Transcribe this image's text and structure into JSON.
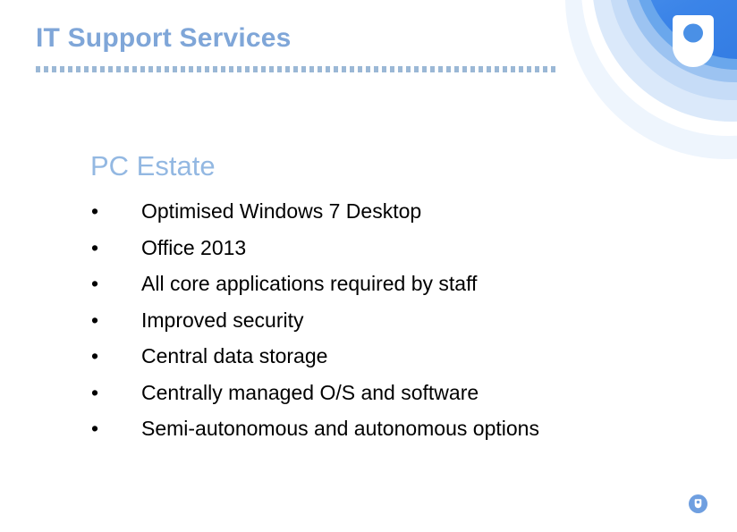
{
  "slide": {
    "title": "IT Support Services",
    "subheading": "PC Estate",
    "bullet_marker": "•",
    "bullets": [
      "Optimised Windows 7 Desktop",
      "Office 2013",
      "All core applications required by staff",
      "Improved security",
      "Central data storage",
      "Centrally managed O/S and software",
      "Semi-autonomous and autonomous options"
    ]
  },
  "branding": {
    "logo_name": "open-university-shield",
    "page_badge_name": "page-badge"
  },
  "colors": {
    "title_blue": "#7fa6d8",
    "subheading_blue": "#93b8e2",
    "rule_blue": "#9bb8d6",
    "ring_core_blue": "#3b84e8",
    "badge_blue": "#6f9fe0",
    "body_text": "#000000",
    "background": "#ffffff"
  }
}
